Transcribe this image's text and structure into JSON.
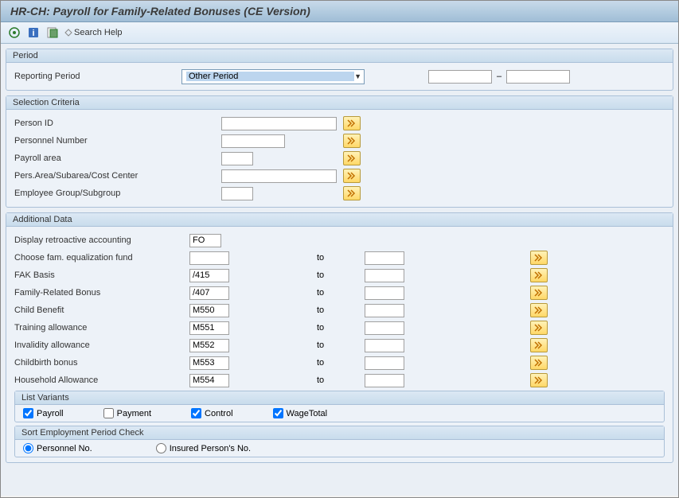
{
  "title": "HR-CH: Payroll for Family-Related Bonuses (CE Version)",
  "toolbar": {
    "search_help": "Search Help"
  },
  "period": {
    "title": "Period",
    "reporting_label": "Reporting Period",
    "reporting_selected": "Other Period",
    "from": "",
    "to": "",
    "dash": "–"
  },
  "selection": {
    "title": "Selection Criteria",
    "rows": [
      {
        "label": "Person ID",
        "width": "w-lg"
      },
      {
        "label": "Personnel Number",
        "width": "w-md"
      },
      {
        "label": "Payroll area",
        "width": "w-sm"
      },
      {
        "label": "Pers.Area/Subarea/Cost Center",
        "width": "w-lg"
      },
      {
        "label": "Employee Group/Subgroup",
        "width": "w-sm"
      }
    ]
  },
  "additional": {
    "title": "Additional Data",
    "retro_label": "Display retroactive accounting",
    "retro_value": "FO",
    "to_label": "to",
    "rows": [
      {
        "label": "Choose fam. equalization fund",
        "from": ""
      },
      {
        "label": "FAK Basis",
        "from": "/415"
      },
      {
        "label": "Family-Related Bonus",
        "from": "/407"
      },
      {
        "label": "Child Benefit",
        "from": "M550"
      },
      {
        "label": "Training allowance",
        "from": "M551"
      },
      {
        "label": "Invalidity allowance",
        "from": "M552"
      },
      {
        "label": "Childbirth bonus",
        "from": "M553"
      },
      {
        "label": "Household Allowance",
        "from": "M554"
      }
    ],
    "list_variants": {
      "title": "List Variants",
      "items": [
        {
          "label": "Payroll",
          "checked": true
        },
        {
          "label": "Payment",
          "checked": false
        },
        {
          "label": "Control",
          "checked": true
        },
        {
          "label": "WageTotal",
          "checked": true
        }
      ]
    },
    "sort": {
      "title": "Sort Employment Period Check",
      "items": [
        {
          "label": "Personnel No.",
          "checked": true
        },
        {
          "label": "Insured Person's No.",
          "checked": false
        }
      ]
    }
  }
}
